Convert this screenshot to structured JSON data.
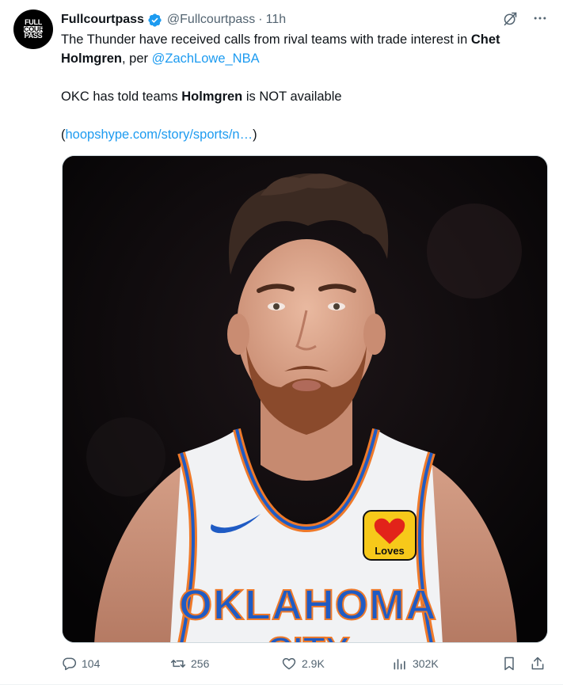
{
  "author": {
    "display_name": "Fullcourtpass",
    "handle": "@Fullcourtpass",
    "separator": "·",
    "time": "11h",
    "avatar_lines": [
      "FULL",
      "COURT",
      "PASS"
    ]
  },
  "tweet": {
    "line1_pre": "The Thunder have received calls from rival teams with trade interest in ",
    "line1_bold": "Chet Holmgren",
    "line1_mid": ", per ",
    "mention": "@ZachLowe_NBA",
    "line2_pre": "OKC has told teams ",
    "line2_bold": "Holmgren",
    "line2_post": " is NOT available",
    "link_open": "(",
    "link_text": "hoopshype.com/story/sports/n…",
    "link_close": ")"
  },
  "media": {
    "jersey_text": "OKLAHOMA",
    "jersey_text_2": "CITY",
    "patch_text": "Loves"
  },
  "actions": {
    "replies": "104",
    "reposts": "256",
    "likes": "2.9K",
    "views": "302K"
  },
  "colors": {
    "accent": "#1d9bf0",
    "muted": "#536471",
    "jersey_blue": "#1f5bc4",
    "jersey_orange": "#ef7a2a"
  },
  "icons": [
    "verified-badge-icon",
    "grok-icon",
    "more-icon",
    "reply-icon",
    "repost-icon",
    "like-icon",
    "views-icon",
    "bookmark-icon",
    "share-icon"
  ]
}
